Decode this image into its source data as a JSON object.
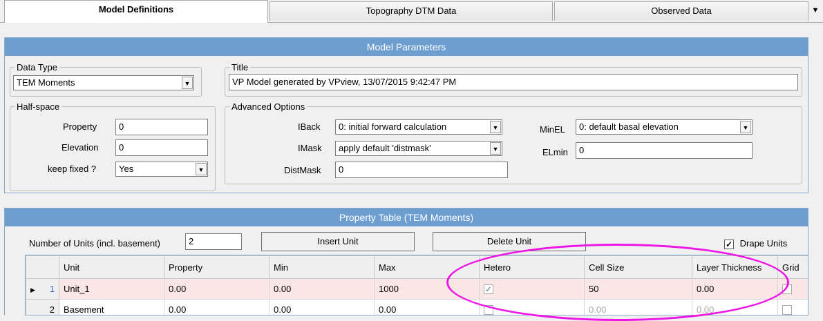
{
  "tabs": [
    {
      "label": "Model Definitions"
    },
    {
      "label": "Topography DTM Data"
    },
    {
      "label": "Observed Data"
    }
  ],
  "tab_scroll_icon": "▼",
  "model_params": {
    "header": "Model Parameters",
    "data_type": {
      "legend": "Data Type",
      "value": "TEM Moments"
    },
    "title": {
      "legend": "Title",
      "value": "VP Model generated by VPview, 13/07/2015 9:42:47 PM"
    },
    "half_space": {
      "legend": "Half-space",
      "property_label": "Property",
      "property_value": "0",
      "elevation_label": "Elevation",
      "elevation_value": "0",
      "keep_fixed_label": "keep fixed ?",
      "keep_fixed_value": "Yes"
    },
    "advanced": {
      "legend": "Advanced Options",
      "iback_label": "IBack",
      "iback_value": "0: initial forward calculation",
      "imask_label": "IMask",
      "imask_value": "apply default 'distmask'",
      "distmask_label": "DistMask",
      "distmask_value": "0",
      "minel_label": "MinEL",
      "minel_value": "0: default basal elevation",
      "elmin_label": "ELmin",
      "elmin_value": "0"
    }
  },
  "property_table": {
    "header": "Property Table (TEM Moments)",
    "num_units_label": "Number of Units (incl. basement)",
    "num_units_value": "2",
    "insert_label": "Insert Unit",
    "delete_label": "Delete Unit",
    "drape_label": "Drape Units",
    "drape_checked": true,
    "columns": [
      "Unit",
      "Property",
      "Min",
      "Max",
      "Hetero",
      "Cell Size",
      "Layer Thickness",
      "Grid"
    ],
    "rows": [
      {
        "num": "1",
        "unit": "Unit_1",
        "property": "0.00",
        "min": "0.00",
        "max": "1000",
        "hetero": true,
        "cell_size": "50",
        "thickness": "0.00",
        "grid": false
      },
      {
        "num": "2",
        "unit": "Basement",
        "property": "0.00",
        "min": "0.00",
        "max": "0.00",
        "hetero": false,
        "cell_size": "0.00",
        "thickness": "0.00",
        "grid": false
      }
    ]
  },
  "icons": {
    "dropdown": "▼",
    "row_pointer": "▶",
    "check": "✓"
  }
}
